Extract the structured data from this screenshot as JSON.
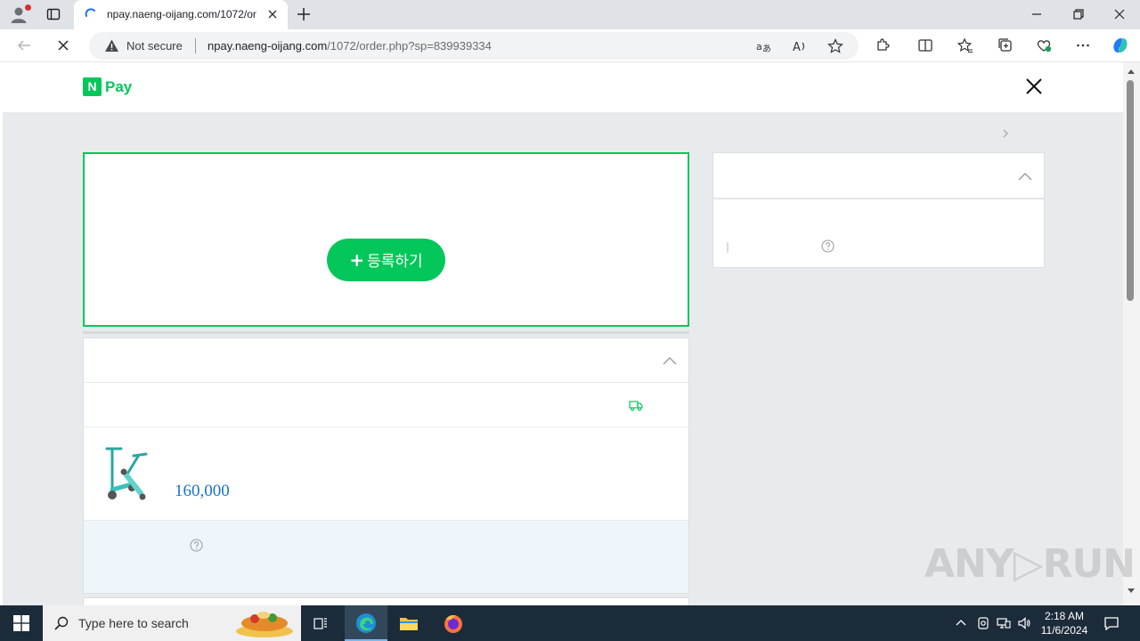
{
  "browser": {
    "tab_title": "npay.naeng-oijang.com/1072/or",
    "security_label": "Not secure",
    "url_host": "npay.naeng-oijang.com",
    "url_path": "/1072/order.php?sp=839939334"
  },
  "page": {
    "logo_letter": "N",
    "logo_text": "Pay",
    "register_button": {
      "plus": "+",
      "label": "등록하기"
    },
    "product": {
      "price": "160,000"
    },
    "accent_color": "#03c75a",
    "price_color": "#1a73c8"
  },
  "watermark": {
    "text": "ANY▷RUN"
  },
  "taskbar": {
    "search_placeholder": "Type here to search",
    "time": "2:18 AM",
    "date": "11/6/2024"
  },
  "icons": [
    "profile-icon",
    "tabs-icon",
    "loading-spinner-icon",
    "close-icon",
    "plus-icon",
    "back-arrow-icon",
    "stop-icon",
    "warning-icon",
    "translate-icon",
    "read-aloud-icon",
    "star-icon",
    "extensions-icon",
    "split-screen-icon",
    "favorites-icon",
    "collections-icon",
    "performance-icon",
    "more-icon",
    "copilot-icon",
    "chevron-right-icon",
    "chevron-up-icon",
    "truck-icon",
    "question-icon",
    "windows-start-icon",
    "search-icon",
    "task-view-icon",
    "edge-icon",
    "file-explorer-icon",
    "firefox-icon",
    "notification-icon"
  ]
}
